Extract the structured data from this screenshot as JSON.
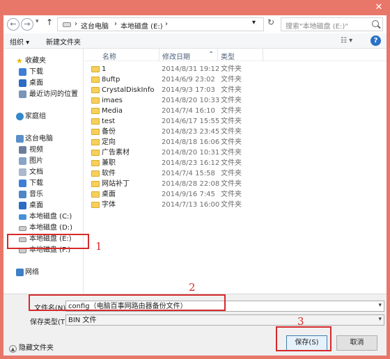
{
  "navigation": {
    "back_symbol": "←",
    "forward_symbol": "→",
    "up_symbol": "↑",
    "breadcrumb": [
      "这台电脑",
      "本地磁盘 (E:)"
    ],
    "search_placeholder": "搜索\"本地磁盘 (E:)\""
  },
  "toolbar": {
    "organize_label": "组织 ▾",
    "new_folder_label": "新建文件夹"
  },
  "sidebar": {
    "favorites": {
      "label": "收藏夹",
      "items": [
        "下载",
        "桌面",
        "最近访问的位置"
      ]
    },
    "homegroup": "家庭组",
    "this_pc": {
      "label": "这台电脑",
      "items": [
        "视频",
        "图片",
        "文档",
        "下载",
        "音乐",
        "桌面",
        "本地磁盘 (C:)",
        "本地磁盘 (D:)",
        "本地磁盘 (E:)",
        "本地磁盘 (F:)"
      ]
    },
    "network": "网络"
  },
  "columns": {
    "name": "名称",
    "date": "修改日期",
    "type": "类型"
  },
  "files": [
    {
      "name": "1",
      "date": "2014/8/31 19:12",
      "type": "文件夹"
    },
    {
      "name": "8uftp",
      "date": "2014/6/9 23:02",
      "type": "文件夹"
    },
    {
      "name": "CrystalDiskInfo",
      "date": "2014/9/3 17:03",
      "type": "文件夹"
    },
    {
      "name": "imaes",
      "date": "2014/8/20 10:33",
      "type": "文件夹"
    },
    {
      "name": "Media",
      "date": "2014/7/4 16:10",
      "type": "文件夹"
    },
    {
      "name": "test",
      "date": "2014/6/17 15:55",
      "type": "文件夹"
    },
    {
      "name": "备份",
      "date": "2014/8/23 23:45",
      "type": "文件夹"
    },
    {
      "name": "定向",
      "date": "2014/8/18 16:06",
      "type": "文件夹"
    },
    {
      "name": "广告素材",
      "date": "2014/8/20 10:31",
      "type": "文件夹"
    },
    {
      "name": "兼职",
      "date": "2014/8/23 16:12",
      "type": "文件夹"
    },
    {
      "name": "软件",
      "date": "2014/7/4 15:58",
      "type": "文件夹"
    },
    {
      "name": "网站补丁",
      "date": "2014/8/28 22:08",
      "type": "文件夹"
    },
    {
      "name": "桌面",
      "date": "2014/9/16 7:45",
      "type": "文件夹"
    },
    {
      "name": "字体",
      "date": "2014/7/13 16:00",
      "type": "文件夹"
    }
  ],
  "save_form": {
    "filename_label": "文件名(N):",
    "filename_value": "config（电脑百事网路由器备份文件）",
    "filetype_label": "保存类型(T):",
    "filetype_value": "BIN 文件",
    "hide_folders": "隐藏文件夹",
    "save_button": "保存(S)",
    "cancel_button": "取消"
  },
  "annotations": [
    "1",
    "2",
    "3"
  ],
  "colors": {
    "frame": "#e8776a",
    "annotation": "#d62929",
    "folder": "#f6cf5c"
  }
}
